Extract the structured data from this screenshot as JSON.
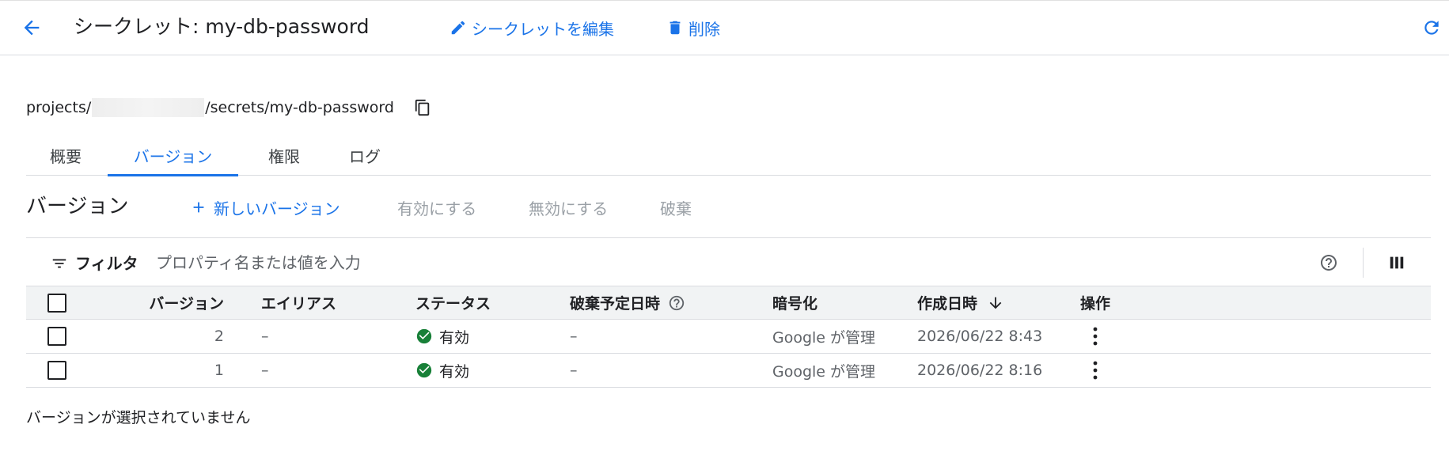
{
  "header": {
    "title": "シークレット: my-db-password",
    "edit_label": "シークレットを編集",
    "delete_label": "削除"
  },
  "resource_path": {
    "prefix": "projects/",
    "suffix": "/secrets/my-db-password"
  },
  "tabs": [
    {
      "label": "概要",
      "active": false
    },
    {
      "label": "バージョン",
      "active": true
    },
    {
      "label": "権限",
      "active": false
    },
    {
      "label": "ログ",
      "active": false
    }
  ],
  "versions_section": {
    "title": "バージョン",
    "new_version_label": "新しいバージョン",
    "enable_label": "有効にする",
    "disable_label": "無効にする",
    "destroy_label": "破棄"
  },
  "filter": {
    "label": "フィルタ",
    "placeholder": "プロパティ名または値を入力"
  },
  "table": {
    "columns": {
      "version": "バージョン",
      "alias": "エイリアス",
      "status": "ステータス",
      "destroy_scheduled": "破棄予定日時",
      "encryption": "暗号化",
      "created": "作成日時",
      "actions": "操作"
    },
    "rows": [
      {
        "version": "2",
        "alias": "–",
        "status": "有効",
        "destroy_scheduled": "–",
        "encryption": "Google が管理",
        "created": "2026/06/22 8:43"
      },
      {
        "version": "1",
        "alias": "–",
        "status": "有効",
        "destroy_scheduled": "–",
        "encryption": "Google が管理",
        "created": "2026/06/22 8:16"
      }
    ]
  },
  "selection_message": "バージョンが選択されていません",
  "colors": {
    "accent": "#1a73e8",
    "success": "#188038",
    "text": "#202124",
    "secondary_text": "#5f6368",
    "disabled": "#9aa0a6"
  },
  "icons": {
    "back": "arrow-back-icon",
    "edit": "pencil-icon",
    "delete": "trash-icon",
    "refresh": "refresh-icon",
    "copy": "copy-icon",
    "add": "plus-icon",
    "filter": "filter-icon",
    "help": "help-icon",
    "columns": "columns-icon",
    "sort": "arrow-down-icon",
    "status": "check-circle-icon",
    "row_actions": "more-vert-icon"
  }
}
